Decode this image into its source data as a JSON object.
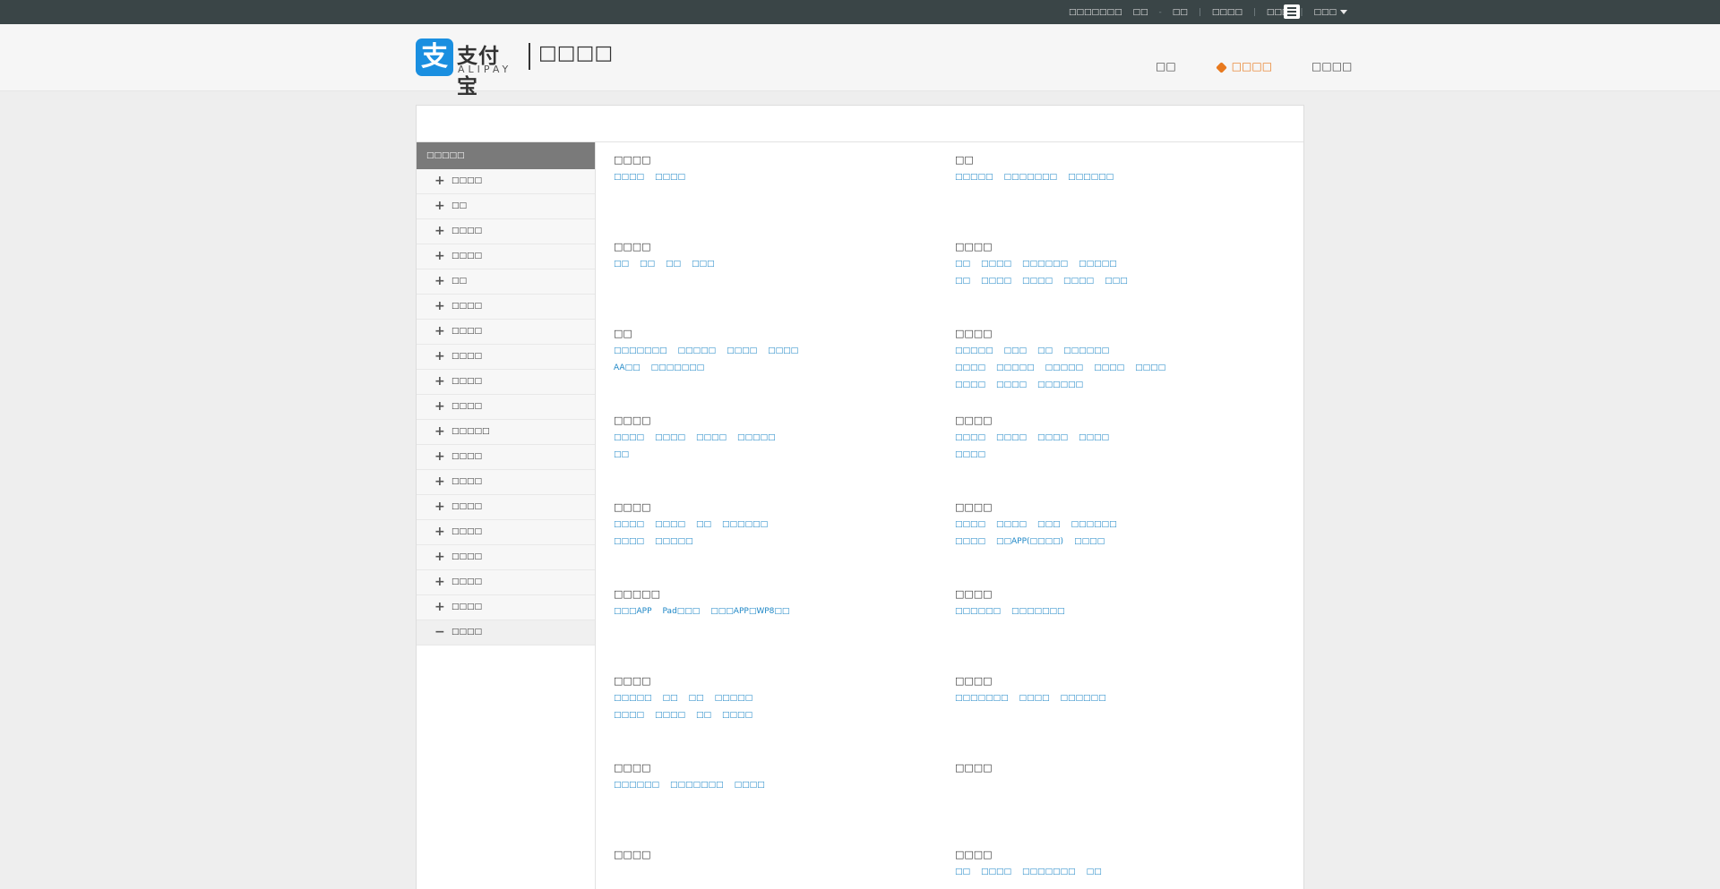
{
  "topbar": {
    "links": [
      "□□□□□□□",
      "□□",
      "□□",
      "□□□□",
      "□□□",
      "□□□"
    ],
    "menu_icon": "list-icon"
  },
  "header": {
    "logo_mark": "支",
    "logo_cn": "支付宝",
    "logo_en": "ALIPAY",
    "site_title": "□□□□",
    "nav": [
      "□□",
      "□□□□",
      "□□□□"
    ],
    "active_nav_index": 1
  },
  "sidebar": {
    "title": "□□□□□",
    "items": [
      {
        "label": "□□□□",
        "expanded": false
      },
      {
        "label": "□□",
        "expanded": false
      },
      {
        "label": "□□□□",
        "expanded": false
      },
      {
        "label": "□□□□",
        "expanded": false
      },
      {
        "label": "□□",
        "expanded": false
      },
      {
        "label": "□□□□",
        "expanded": false
      },
      {
        "label": "□□□□",
        "expanded": false
      },
      {
        "label": "□□□□",
        "expanded": false
      },
      {
        "label": "□□□□",
        "expanded": false
      },
      {
        "label": "□□□□",
        "expanded": false
      },
      {
        "label": "□□□□□",
        "expanded": false
      },
      {
        "label": "□□□□",
        "expanded": false
      },
      {
        "label": "□□□□",
        "expanded": false
      },
      {
        "label": "□□□□",
        "expanded": false
      },
      {
        "label": "□□□□",
        "expanded": false
      },
      {
        "label": "□□□□",
        "expanded": false
      },
      {
        "label": "□□□□",
        "expanded": false
      },
      {
        "label": "□□□□",
        "expanded": false
      },
      {
        "label": "□□□□",
        "expanded": true
      }
    ]
  },
  "categories": [
    {
      "title": "□□□□",
      "rows": [
        [
          "□□□□",
          "□□□□"
        ]
      ]
    },
    {
      "title": "□□",
      "rows": [
        [
          "□□□□□",
          "□□□□□□□",
          "□□□□□□"
        ]
      ]
    },
    {
      "title": "□□□□",
      "rows": [
        [
          "□□",
          "□□",
          "□□",
          "□□□"
        ]
      ]
    },
    {
      "title": "□□□□",
      "rows": [
        [
          "□□",
          "□□□□",
          "□□□□□□",
          "□□□□□"
        ],
        [
          "□□",
          "□□□□",
          "□□□□",
          "□□□□",
          "□□□"
        ]
      ]
    },
    {
      "title": "□□",
      "rows": [
        [
          "□□□□□□□",
          "□□□□□",
          "□□□□",
          "□□□□"
        ],
        [
          "AA□□",
          "□□□□□□□"
        ]
      ]
    },
    {
      "title": "□□□□",
      "rows": [
        [
          "□□□□□",
          "□□□",
          "□□",
          "□□□□□□"
        ],
        [
          "□□□□",
          "□□□□□",
          "□□□□□",
          "□□□□",
          "□□□□"
        ],
        [
          "□□□□",
          "□□□□",
          "□□□□□□"
        ]
      ]
    },
    {
      "title": "□□□□",
      "rows": [
        [
          "□□□□",
          "□□□□",
          "□□□□",
          "□□□□□"
        ],
        [
          "□□"
        ]
      ]
    },
    {
      "title": "□□□□",
      "rows": [
        [
          "□□□□",
          "□□□□",
          "□□□□",
          "□□□□"
        ],
        [
          "□□□□"
        ]
      ]
    },
    {
      "title": "□□□□",
      "rows": [
        [
          "□□□□",
          "□□□□",
          "□□",
          "□□□□□□"
        ],
        [
          "□□□□",
          "□□□□□"
        ]
      ]
    },
    {
      "title": "□□□□",
      "rows": [
        [
          "□□□□",
          "□□□□",
          "□□□",
          "□□□□□□"
        ],
        [
          "□□□□",
          "□□APP(□□□□)",
          "□□□□"
        ]
      ]
    },
    {
      "title": "□□□□□",
      "rows": [
        [
          "□□□APP",
          "Pad□□□",
          "□□□APP□WP8□□"
        ]
      ]
    },
    {
      "title": "□□□□",
      "rows": [
        [
          "□□□□□□",
          "□□□□□□□"
        ]
      ]
    },
    {
      "title": "□□□□",
      "rows": [
        [
          "□□□□□",
          "□□",
          "□□",
          "□□□□□"
        ],
        [
          "□□□□",
          "□□□□",
          "□□",
          "□□□□"
        ]
      ]
    },
    {
      "title": "□□□□",
      "rows": [
        [
          "□□□□□□□",
          "□□□□",
          "□□□□□□"
        ]
      ]
    },
    {
      "title": "□□□□",
      "rows": [
        [
          "□□□□□□",
          "□□□□□□□",
          "□□□□"
        ]
      ]
    },
    {
      "title": "□□□□",
      "rows": []
    },
    {
      "title": "□□□□",
      "rows": []
    },
    {
      "title": "□□□□",
      "rows": [
        [
          "□□",
          "□□□□",
          "□□□□□□□",
          "□□"
        ]
      ]
    }
  ]
}
